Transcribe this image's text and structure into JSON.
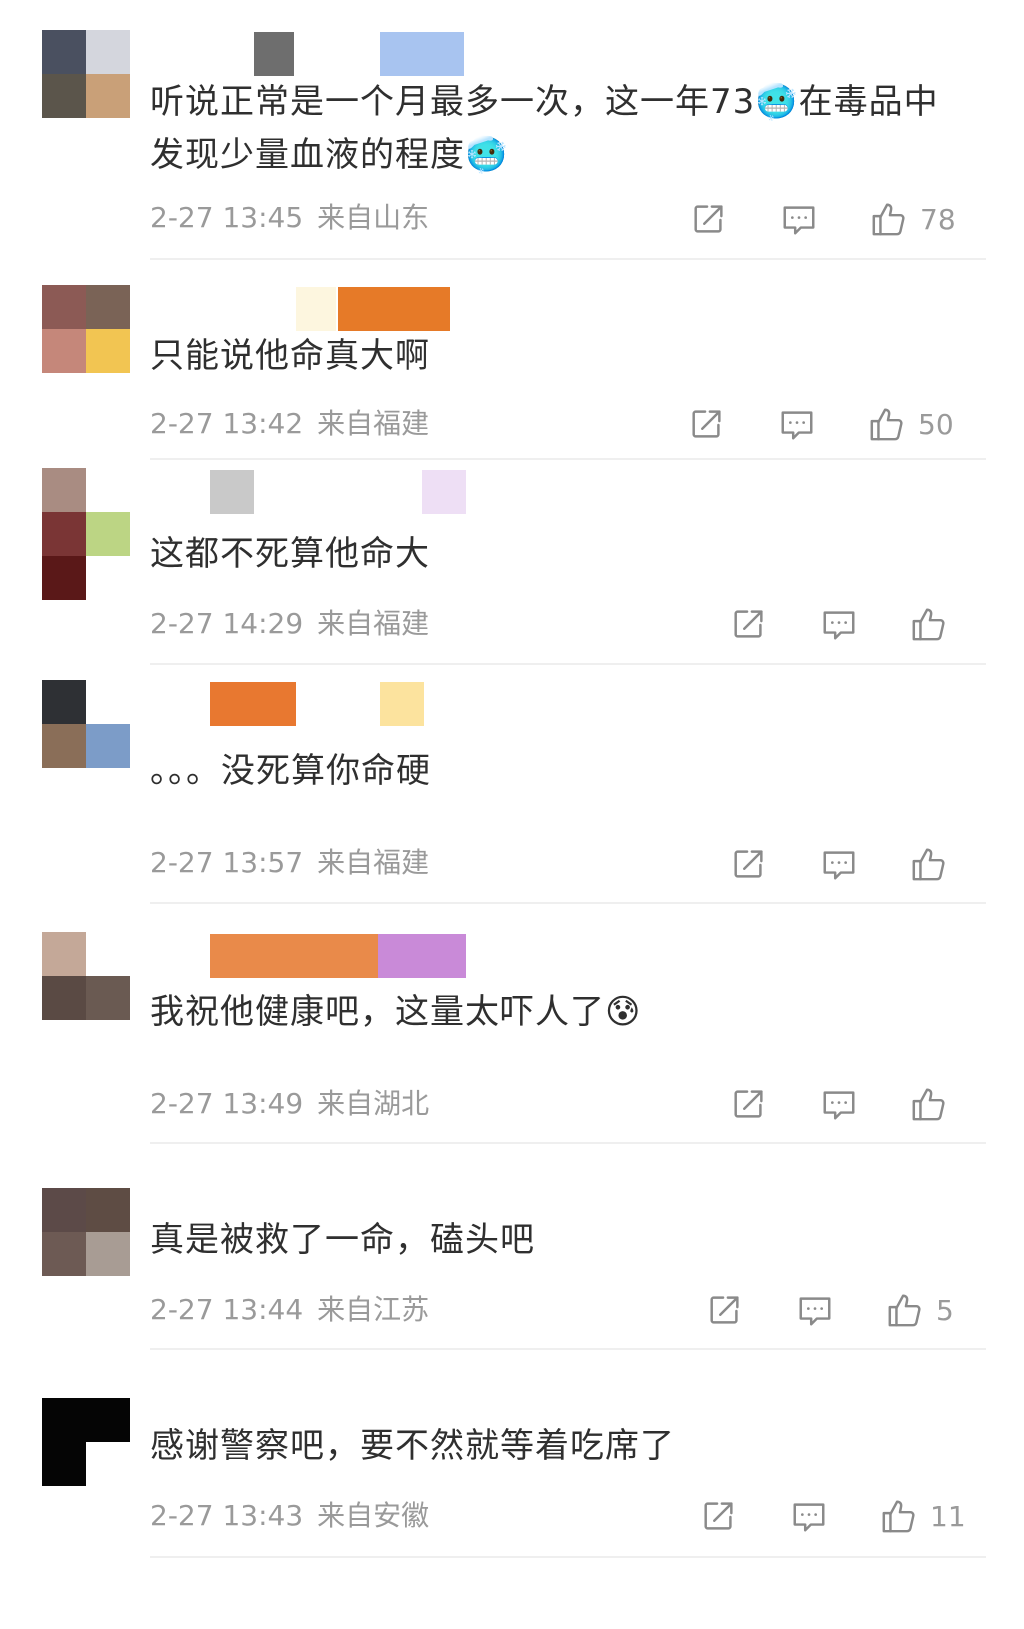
{
  "comments": [
    {
      "text_lines": [
        "听说正常是一个月最多一次，这一年73🥶在毒品中",
        "发现少量血液的程度🥶"
      ],
      "time": "2-27 13:45",
      "location": "来自山东",
      "likes": "78"
    },
    {
      "text_lines": [
        "只能说他命真大啊"
      ],
      "time": "2-27 13:42",
      "location": "来自福建",
      "likes": "50"
    },
    {
      "text_lines": [
        "这都不死算他命大"
      ],
      "time": "2-27 14:29",
      "location": "来自福建",
      "likes": ""
    },
    {
      "text_lines": [
        "。。。没死算你命硬"
      ],
      "time": "2-27 13:57",
      "location": "来自福建",
      "likes": ""
    },
    {
      "text_lines": [
        "我祝他健康吧，这量太吓人了😰"
      ],
      "time": "2-27 13:49",
      "location": "来自湖北",
      "likes": ""
    },
    {
      "text_lines": [
        "真是被救了一命，磕头吧"
      ],
      "time": "2-27 13:44",
      "location": "来自江苏",
      "likes": "5"
    },
    {
      "text_lines": [
        "感谢警察吧，要不然就等着吃席了"
      ],
      "time": "2-27 13:43",
      "location": "来自安徽",
      "likes": "11"
    }
  ],
  "icons": {
    "share": "share-icon",
    "comment": "comment-icon",
    "like": "thumbs-up-icon"
  },
  "colors": {
    "text": "#2f2f2f",
    "meta": "#9a9a9a",
    "icon": "#8a8a8a",
    "divider": "#efefef"
  }
}
